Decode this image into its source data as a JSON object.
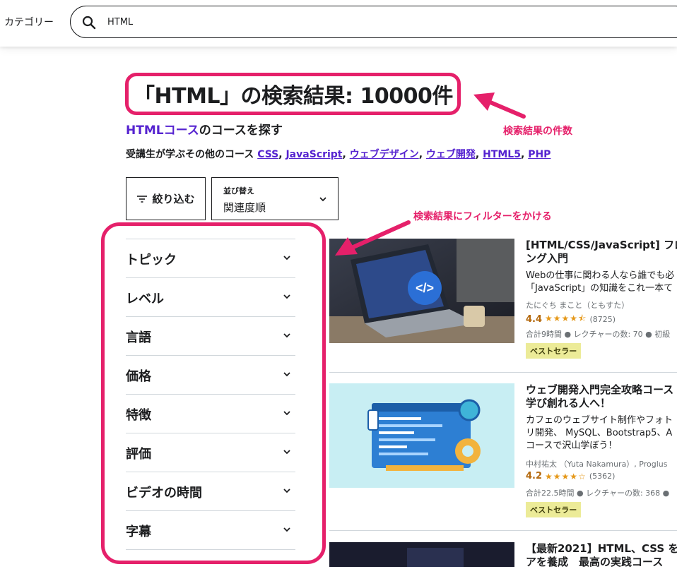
{
  "header": {
    "category_label": "カテゴリー",
    "search_value": "HTML"
  },
  "results": {
    "title": "「HTML」の検索結果: 10000件",
    "explore_accent": "HTMLコース",
    "explore_rest": "のコースを探す",
    "related_prefix": "受講生が学ぶその他のコース",
    "related_topics": [
      "CSS",
      "JavaScript",
      "ウェブデザイン",
      "ウェブ開発",
      "HTML5",
      "PHP"
    ]
  },
  "annotations": {
    "count_note": "検索結果の件数",
    "filter_note": "検索結果にフィルターをかける",
    "highlight_color": "#e5206a"
  },
  "controls": {
    "filter_label": "絞り込む",
    "sort_label": "並び替え",
    "sort_value": "関連度順"
  },
  "facets": [
    "トピック",
    "レベル",
    "言語",
    "価格",
    "特徴",
    "評価",
    "ビデオの時間",
    "字幕"
  ],
  "courses": [
    {
      "title_lines": [
        "[HTML/CSS/JavaScript] フロ",
        "ング入門"
      ],
      "desc_lines": [
        "Webの仕事に関わる人なら誰でも必",
        "「JavaScript」の知識をこれ一本て"
      ],
      "instructor": "たにぐち まこと（ともすた）",
      "rating": "4.4",
      "stars": 4.4,
      "rating_count": "(8725)",
      "meta": "合計9時間 ● レクチャーの数: 70 ● 初級",
      "badge": "ベストセラー"
    },
    {
      "title_lines": [
        "ウェブ開発入門完全攻略コース",
        "学び創れる人へ！"
      ],
      "desc_lines": [
        "カフェのウェブサイト制作やフォト",
        "リ開発、 MySQL、Bootstrap5、A",
        "コースで沢山学ぼう！"
      ],
      "instructor": "中村祐太 （Yuta Nakamura）, Proglus",
      "rating": "4.2",
      "stars": 4.2,
      "rating_count": "(5362)",
      "meta": "合計22.5時間 ● レクチャーの数: 368 ●",
      "badge": "ベストセラー"
    },
    {
      "title_lines": [
        "【最新2021】HTML、CSS を",
        "アを養成　最高の実践コース"
      ]
    }
  ],
  "colors": {
    "accent_link": "#5624d0",
    "rating": "#b4690e",
    "star": "#e59819",
    "badge_bg": "#eceb98"
  }
}
